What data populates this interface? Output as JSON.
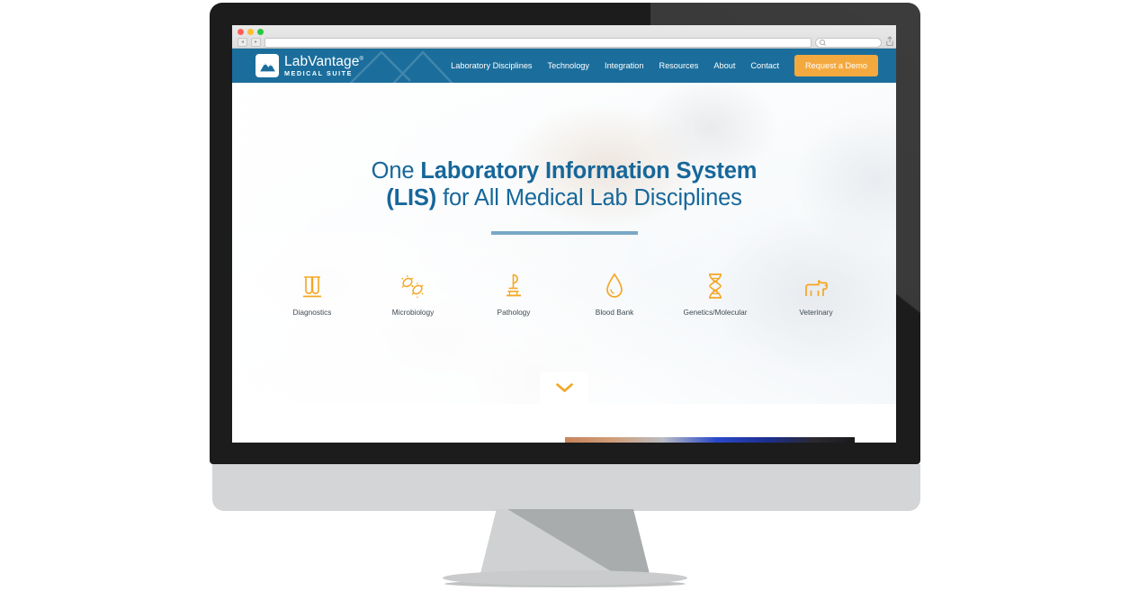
{
  "browser": {
    "address_value": "",
    "address_placeholder": "",
    "search_placeholder": "",
    "back_glyph": "◂",
    "forward_glyph": "▸",
    "share_icon": "share-icon",
    "traffic_lights": [
      "close",
      "minimize",
      "zoom"
    ]
  },
  "site": {
    "brand": {
      "name": "LabVantage",
      "trademark": "®",
      "subtitle": "MEDICAL SUITE"
    },
    "nav": {
      "links": [
        {
          "label": "Laboratory Disciplines"
        },
        {
          "label": "Technology"
        },
        {
          "label": "Integration"
        },
        {
          "label": "Resources"
        },
        {
          "label": "About"
        },
        {
          "label": "Contact"
        }
      ],
      "cta_label": "Request a Demo"
    },
    "hero": {
      "headline_part1": "One ",
      "headline_bold1": "Laboratory Information System",
      "headline_bold2": "(LIS)",
      "headline_part2": " for All Medical Lab Disciplines",
      "disciplines": [
        {
          "label": "Diagnostics",
          "icon": "test-tubes-icon"
        },
        {
          "label": "Microbiology",
          "icon": "bacteria-icon"
        },
        {
          "label": "Pathology",
          "icon": "microscope-icon"
        },
        {
          "label": "Blood Bank",
          "icon": "blood-drop-icon"
        },
        {
          "label": "Genetics/Molecular",
          "icon": "dna-icon"
        },
        {
          "label": "Veterinary",
          "icon": "dog-icon"
        }
      ],
      "scroll_cue_icon": "chevron-down-icon"
    }
  },
  "colors": {
    "nav_blue": "#1b6e9c",
    "heading_blue": "#16679a",
    "accent_orange": "#f5a623",
    "cta_orange": "#f4a93f",
    "rule_blue": "#79a8c6"
  }
}
